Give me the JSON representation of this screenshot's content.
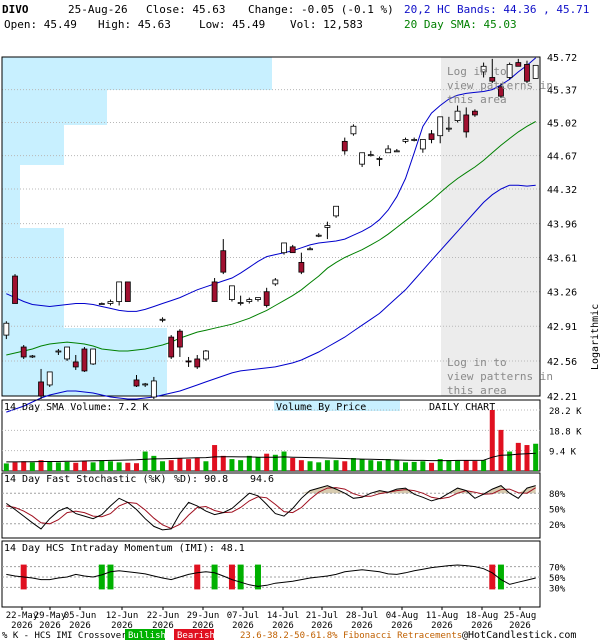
{
  "header": {
    "symbol": "DIVO",
    "date": "25-Aug-26",
    "close": "Close: 45.63",
    "change": "Change: -0.05 (-0.1 %)",
    "open": "Open: 45.49",
    "high": "High: 45.63",
    "low": "Low: 45.49",
    "volume": "Vol: 12,583",
    "bands": "20,2 HC Bands: 44.36 , 45.71",
    "sma": "20 Day SMA: 45.03"
  },
  "colors": {
    "up": "#ffffff",
    "down": "#a01030",
    "band": "#0000cc",
    "sma": "#008000",
    "volume_up": "#00b000",
    "volume_down": "#e01020",
    "vbp": "#c8f0ff",
    "shade": "#ececec",
    "stoch_k": "#000000",
    "stoch_d": "#a01020",
    "stoch_fill": "#d8ccb0"
  },
  "chart_data": [
    {
      "type": "candlestick",
      "scale": "log",
      "ylabel": "Logarithmic",
      "yticks": [
        "45.72",
        "45.37",
        "45.02",
        "44.67",
        "44.32",
        "43.96",
        "43.61",
        "43.26",
        "42.91",
        "42.56",
        "42.21"
      ],
      "ylim": [
        42.21,
        45.72
      ],
      "xticks": [
        "22-May 2026",
        "29-May 2026",
        "05-Jun 2026",
        "12-Jun 2026",
        "22-Jun 2026",
        "29-Jun 2026",
        "07-Jul 2026",
        "14-Jul 2026",
        "21-Jul 2026",
        "28-Jul 2026",
        "04-Aug 2026",
        "11-Aug 2026",
        "18-Aug 2026",
        "25-Aug 2026"
      ],
      "annotations": [
        "Log in to view patterns in this area",
        "Log in to view patterns in this area"
      ],
      "candles": [
        {
          "o": 42.82,
          "h": 42.96,
          "l": 42.78,
          "c": 42.94
        },
        {
          "o": 43.42,
          "h": 43.44,
          "l": 43.14,
          "c": 43.14
        },
        {
          "o": 42.7,
          "h": 42.72,
          "l": 42.58,
          "c": 42.6
        },
        {
          "o": 42.6,
          "h": 42.62,
          "l": 42.59,
          "c": 42.61
        },
        {
          "o": 42.35,
          "h": 42.48,
          "l": 42.18,
          "c": 42.21
        },
        {
          "o": 42.32,
          "h": 42.45,
          "l": 42.3,
          "c": 42.45
        },
        {
          "o": 42.66,
          "h": 42.68,
          "l": 42.62,
          "c": 42.66
        },
        {
          "o": 42.58,
          "h": 42.7,
          "l": 42.56,
          "c": 42.7
        },
        {
          "o": 42.55,
          "h": 42.62,
          "l": 42.47,
          "c": 42.5
        },
        {
          "o": 42.68,
          "h": 42.7,
          "l": 42.45,
          "c": 42.46
        },
        {
          "o": 42.53,
          "h": 42.68,
          "l": 42.52,
          "c": 42.68
        },
        {
          "o": 43.14,
          "h": 43.15,
          "l": 43.13,
          "c": 43.14
        },
        {
          "o": 43.14,
          "h": 43.18,
          "l": 43.12,
          "c": 43.16
        },
        {
          "o": 43.16,
          "h": 43.36,
          "l": 43.12,
          "c": 43.36
        },
        {
          "o": 43.36,
          "h": 43.36,
          "l": 43.16,
          "c": 43.16
        },
        {
          "o": 42.37,
          "h": 42.42,
          "l": 42.3,
          "c": 42.31
        },
        {
          "o": 42.32,
          "h": 42.34,
          "l": 42.3,
          "c": 42.33
        },
        {
          "o": 42.2,
          "h": 42.4,
          "l": 42.18,
          "c": 42.36
        },
        {
          "o": 42.98,
          "h": 43.0,
          "l": 42.95,
          "c": 42.98
        },
        {
          "o": 42.8,
          "h": 42.82,
          "l": 42.58,
          "c": 42.6
        },
        {
          "o": 42.86,
          "h": 42.88,
          "l": 42.6,
          "c": 42.7
        },
        {
          "o": 42.56,
          "h": 42.6,
          "l": 42.5,
          "c": 42.55
        },
        {
          "o": 42.58,
          "h": 42.62,
          "l": 42.48,
          "c": 42.5
        },
        {
          "o": 42.58,
          "h": 42.67,
          "l": 42.56,
          "c": 42.66
        },
        {
          "o": 43.36,
          "h": 43.4,
          "l": 43.16,
          "c": 43.16
        },
        {
          "o": 43.68,
          "h": 43.8,
          "l": 43.44,
          "c": 43.46
        },
        {
          "o": 43.18,
          "h": 43.32,
          "l": 43.16,
          "c": 43.32
        },
        {
          "o": 43.14,
          "h": 43.22,
          "l": 43.12,
          "c": 43.15
        },
        {
          "o": 43.16,
          "h": 43.2,
          "l": 43.14,
          "c": 43.18
        },
        {
          "o": 43.18,
          "h": 43.2,
          "l": 43.16,
          "c": 43.2
        },
        {
          "o": 43.26,
          "h": 43.3,
          "l": 43.1,
          "c": 43.12
        },
        {
          "o": 43.34,
          "h": 43.4,
          "l": 43.32,
          "c": 43.38
        },
        {
          "o": 43.66,
          "h": 43.76,
          "l": 43.64,
          "c": 43.76
        },
        {
          "o": 43.72,
          "h": 43.74,
          "l": 43.66,
          "c": 43.66
        },
        {
          "o": 43.56,
          "h": 43.66,
          "l": 43.44,
          "c": 43.46
        },
        {
          "o": 43.7,
          "h": 43.72,
          "l": 43.69,
          "c": 43.7
        },
        {
          "o": 43.84,
          "h": 43.86,
          "l": 43.82,
          "c": 43.84
        },
        {
          "o": 43.92,
          "h": 43.98,
          "l": 43.8,
          "c": 43.94
        },
        {
          "o": 44.04,
          "h": 44.14,
          "l": 44.02,
          "c": 44.14
        },
        {
          "o": 44.82,
          "h": 44.86,
          "l": 44.68,
          "c": 44.72
        },
        {
          "o": 44.9,
          "h": 45.0,
          "l": 44.88,
          "c": 44.98
        },
        {
          "o": 44.58,
          "h": 44.7,
          "l": 44.55,
          "c": 44.7
        },
        {
          "o": 44.68,
          "h": 44.72,
          "l": 44.66,
          "c": 44.68
        },
        {
          "o": 44.64,
          "h": 44.66,
          "l": 44.56,
          "c": 44.64
        },
        {
          "o": 44.7,
          "h": 44.78,
          "l": 44.7,
          "c": 44.74
        },
        {
          "o": 44.72,
          "h": 44.74,
          "l": 44.71,
          "c": 44.72
        },
        {
          "o": 44.82,
          "h": 44.86,
          "l": 44.8,
          "c": 44.84
        },
        {
          "o": 44.84,
          "h": 44.86,
          "l": 44.82,
          "c": 44.84
        },
        {
          "o": 44.74,
          "h": 44.84,
          "l": 44.7,
          "c": 44.84
        },
        {
          "o": 44.9,
          "h": 44.94,
          "l": 44.8,
          "c": 44.84
        },
        {
          "o": 44.88,
          "h": 45.08,
          "l": 44.8,
          "c": 45.08
        },
        {
          "o": 44.96,
          "h": 45.08,
          "l": 44.92,
          "c": 44.96
        },
        {
          "o": 45.04,
          "h": 45.2,
          "l": 45.02,
          "c": 45.14
        },
        {
          "o": 45.1,
          "h": 45.18,
          "l": 44.86,
          "c": 44.92
        },
        {
          "o": 45.14,
          "h": 45.16,
          "l": 45.08,
          "c": 45.1
        },
        {
          "o": 45.56,
          "h": 45.66,
          "l": 45.5,
          "c": 45.62
        },
        {
          "o": 45.5,
          "h": 45.7,
          "l": 45.44,
          "c": 45.46
        },
        {
          "o": 45.4,
          "h": 45.44,
          "l": 45.28,
          "c": 45.3
        },
        {
          "o": 45.5,
          "h": 45.66,
          "l": 45.48,
          "c": 45.64
        },
        {
          "o": 45.66,
          "h": 45.7,
          "l": 45.62,
          "c": 45.62
        },
        {
          "o": 45.64,
          "h": 45.68,
          "l": 45.44,
          "c": 45.46
        },
        {
          "o": 45.49,
          "h": 45.63,
          "l": 45.49,
          "c": 45.63
        }
      ],
      "upper_band": [
        43.24,
        43.2,
        43.16,
        43.13,
        43.12,
        43.11,
        43.12,
        43.13,
        43.14,
        43.14,
        43.13,
        43.11,
        43.09,
        43.07,
        43.06,
        43.06,
        43.08,
        43.11,
        43.14,
        43.17,
        43.2,
        43.24,
        43.28,
        43.31,
        43.34,
        43.37,
        43.4,
        43.45,
        43.51,
        43.57,
        43.62,
        43.64,
        43.66,
        43.68,
        43.71,
        43.74,
        43.76,
        43.77,
        43.78,
        43.8,
        43.84,
        43.88,
        43.93,
        44.0,
        44.1,
        44.24,
        44.43,
        44.7,
        44.98,
        45.12,
        45.2,
        45.27,
        45.31,
        45.33,
        45.34,
        45.35,
        45.37,
        45.42,
        45.48,
        45.56,
        45.63,
        45.71
      ],
      "sma": [
        42.62,
        42.64,
        42.66,
        42.68,
        42.71,
        42.73,
        42.74,
        42.75,
        42.74,
        42.73,
        42.71,
        42.68,
        42.67,
        42.66,
        42.66,
        42.67,
        42.68,
        42.7,
        42.72,
        42.75,
        42.79,
        42.82,
        42.85,
        42.87,
        42.89,
        42.91,
        42.93,
        42.96,
        42.99,
        43.03,
        43.07,
        43.12,
        43.17,
        43.22,
        43.28,
        43.35,
        43.42,
        43.5,
        43.56,
        43.61,
        43.65,
        43.69,
        43.74,
        43.79,
        43.85,
        43.92,
        43.99,
        44.06,
        44.13,
        44.2,
        44.28,
        44.36,
        44.43,
        44.49,
        44.55,
        44.62,
        44.7,
        44.78,
        44.85,
        44.92,
        44.98,
        45.03
      ],
      "lower_band": [
        42.05,
        42.08,
        42.11,
        42.15,
        42.19,
        42.22,
        42.24,
        42.26,
        42.26,
        42.25,
        42.24,
        42.22,
        42.2,
        42.19,
        42.18,
        42.18,
        42.19,
        42.2,
        42.22,
        42.24,
        42.26,
        42.29,
        42.32,
        42.35,
        42.38,
        42.41,
        42.44,
        42.46,
        42.47,
        42.48,
        42.49,
        42.5,
        42.52,
        42.54,
        42.57,
        42.61,
        42.65,
        42.7,
        42.75,
        42.8,
        42.86,
        42.92,
        42.98,
        43.04,
        43.12,
        43.2,
        43.28,
        43.38,
        43.48,
        43.58,
        43.68,
        43.78,
        43.88,
        43.98,
        44.08,
        44.18,
        44.26,
        44.32,
        44.36,
        44.36,
        44.35,
        44.36
      ]
    },
    {
      "type": "bar",
      "title": "14 Day SMA Volume: 7.2 K",
      "labels": [
        "Volume By Price",
        "DAILY CHART"
      ],
      "yticks": [
        "28.2 K",
        "18.8 K",
        "9.4 K"
      ],
      "ylim": [
        0,
        28.2
      ],
      "values": [
        3.5,
        4.0,
        4.5,
        4.0,
        5.0,
        4.5,
        4.0,
        4.2,
        3.8,
        4.5,
        4.0,
        5.0,
        4.5,
        4.0,
        3.8,
        3.6,
        9.0,
        7.0,
        4.5,
        5.0,
        6.0,
        5.5,
        6.0,
        4.5,
        12.0,
        7.0,
        5.5,
        5.0,
        7.0,
        6.5,
        8.0,
        7.5,
        9.0,
        6.0,
        5.0,
        4.5,
        4.0,
        5.0,
        5.0,
        4.5,
        6.0,
        5.5,
        5.0,
        4.5,
        5.5,
        5.0,
        4.0,
        4.2,
        4.5,
        3.8,
        5.5,
        5.0,
        4.8,
        5.0,
        4.6,
        5.0,
        28.2,
        19.0,
        9.0,
        13.0,
        12.0,
        12.6
      ],
      "sma_values": [
        4.2,
        4.2,
        4.3,
        4.3,
        4.4,
        4.4,
        4.4,
        4.5,
        4.5,
        4.6,
        4.7,
        4.8,
        4.9,
        5.0,
        5.1,
        5.2,
        5.4,
        5.6,
        5.7,
        5.8,
        5.9,
        6.0,
        6.1,
        6.2,
        6.5,
        6.6,
        6.6,
        6.5,
        6.5,
        6.4,
        6.4,
        6.4,
        6.5,
        6.4,
        6.3,
        6.2,
        6.1,
        6.0,
        5.9,
        5.8,
        5.6,
        5.5,
        5.4,
        5.3,
        5.2,
        5.1,
        5.0,
        4.9,
        4.9,
        4.8,
        4.8,
        4.8,
        4.9,
        4.9,
        4.9,
        5.0,
        6.4,
        7.3,
        7.4,
        7.8,
        8.0,
        8.2
      ]
    },
    {
      "type": "line",
      "title": "14 Day Fast Stochastic (%K)",
      "legend": [
        "%D): 90.8",
        "94.6"
      ],
      "yticks": [
        "80%",
        "50%",
        "20%"
      ],
      "ylim": [
        0,
        100
      ],
      "k": [
        60,
        48,
        35,
        22,
        10,
        30,
        45,
        52,
        40,
        35,
        30,
        38,
        55,
        70,
        62,
        48,
        30,
        15,
        8,
        10,
        40,
        62,
        55,
        45,
        38,
        42,
        50,
        65,
        80,
        75,
        58,
        40,
        35,
        50,
        70,
        85,
        90,
        95,
        88,
        80,
        70,
        72,
        80,
        85,
        82,
        88,
        90,
        78,
        72,
        65,
        70,
        80,
        90,
        85,
        70,
        78,
        88,
        95,
        80,
        70,
        90,
        95
      ],
      "d": [
        55,
        52,
        45,
        35,
        22,
        20,
        28,
        42,
        45,
        42,
        35,
        34,
        40,
        55,
        62,
        60,
        47,
        31,
        18,
        11,
        19,
        37,
        52,
        54,
        46,
        42,
        43,
        52,
        65,
        73,
        71,
        58,
        44,
        42,
        52,
        68,
        82,
        90,
        91,
        88,
        79,
        74,
        74,
        79,
        82,
        85,
        87,
        85,
        80,
        72,
        69,
        72,
        80,
        85,
        82,
        78,
        79,
        87,
        88,
        81,
        80,
        90.8
      ]
    },
    {
      "type": "line",
      "title": "14 Day HCS Intraday Momentum (IMI): 48.1",
      "yticks": [
        "70%",
        "50%",
        "30%"
      ],
      "ylim": [
        0,
        100
      ],
      "imi": [
        55,
        52,
        50,
        48,
        45,
        45,
        48,
        50,
        55,
        52,
        50,
        54,
        60,
        62,
        60,
        58,
        56,
        52,
        48,
        45,
        50,
        55,
        58,
        60,
        58,
        52,
        45,
        40,
        35,
        32,
        34,
        38,
        40,
        42,
        45,
        48,
        50,
        52,
        55,
        60,
        62,
        64,
        62,
        60,
        56,
        55,
        58,
        62,
        65,
        68,
        70,
        72,
        73,
        72,
        70,
        66,
        58,
        45,
        36,
        40,
        44,
        48.1
      ],
      "bullish_bars": [
        11,
        12,
        24,
        27,
        29,
        57
      ],
      "bearish_bars": [
        2,
        22,
        26,
        56
      ]
    }
  ],
  "footer": {
    "legend_prefix": "% K - HCS IMI Crossover:",
    "bullish": "Bullish",
    "bearish": "Bearish",
    "fib": "23.6-38.2-50-61.8% Fibonacci Retracements",
    "brand": "@HotCandlestick.com"
  }
}
